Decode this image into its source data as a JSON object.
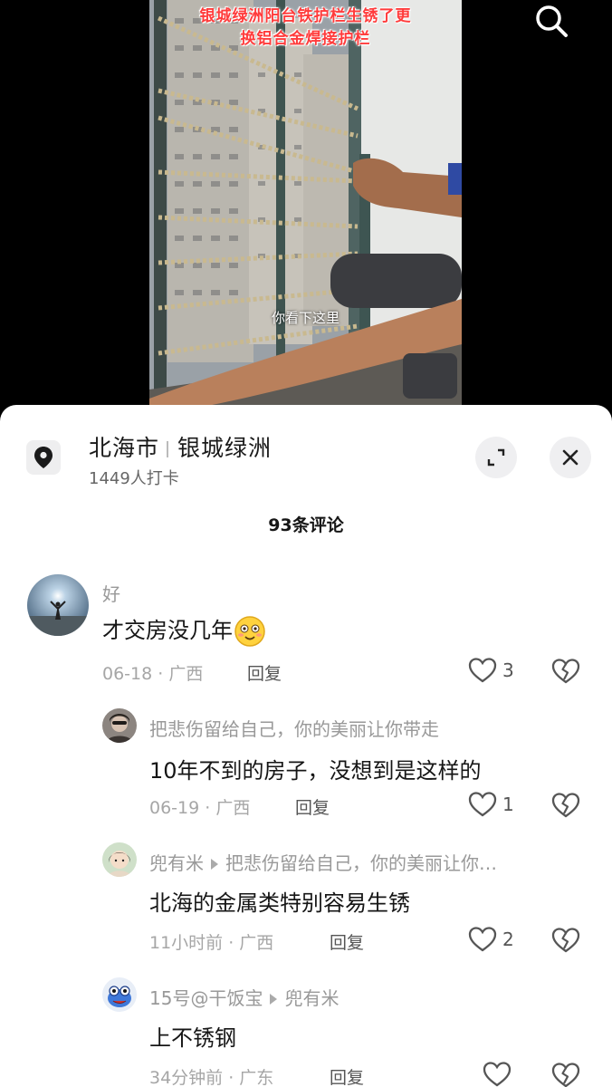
{
  "video": {
    "caption_top_line1": "银城绿洲阳台铁护栏生锈了更",
    "caption_top_line2": "换铝合金焊接护栏",
    "subtitle": "你看下这里"
  },
  "location": {
    "city": "北海市",
    "place": "银城绿洲",
    "checkins": "1449人打卡"
  },
  "comments_header": "93条评论",
  "comments": [
    {
      "user": "好",
      "text": "才交房没几年",
      "emoji": "smiling-face-emoji",
      "time": "06-18 · 广西",
      "reply": "回复",
      "likes": "3"
    },
    {
      "user": "把悲伤留给自己，你的美丽让你带走",
      "text": "10年不到的房子，没想到是这样的",
      "time": "06-19 · 广西",
      "reply": "回复",
      "likes": "1"
    },
    {
      "user": "兜有米",
      "reply_to": "把悲伤留给自己，你的美丽让你…",
      "text": "北海的金属类特别容易生锈",
      "time": "11小时前 · 广西",
      "reply": "回复",
      "likes": "2"
    },
    {
      "user": "15号@干饭宝",
      "reply_to": "兜有米",
      "text": "上不锈钢",
      "time": "34分钟前 · 广东",
      "reply": "回复",
      "likes": ""
    }
  ],
  "colors": {
    "caption_red": "#ff3b3b",
    "meta_gray": "#a6a6a6",
    "sheet_bg": "#ffffff"
  }
}
